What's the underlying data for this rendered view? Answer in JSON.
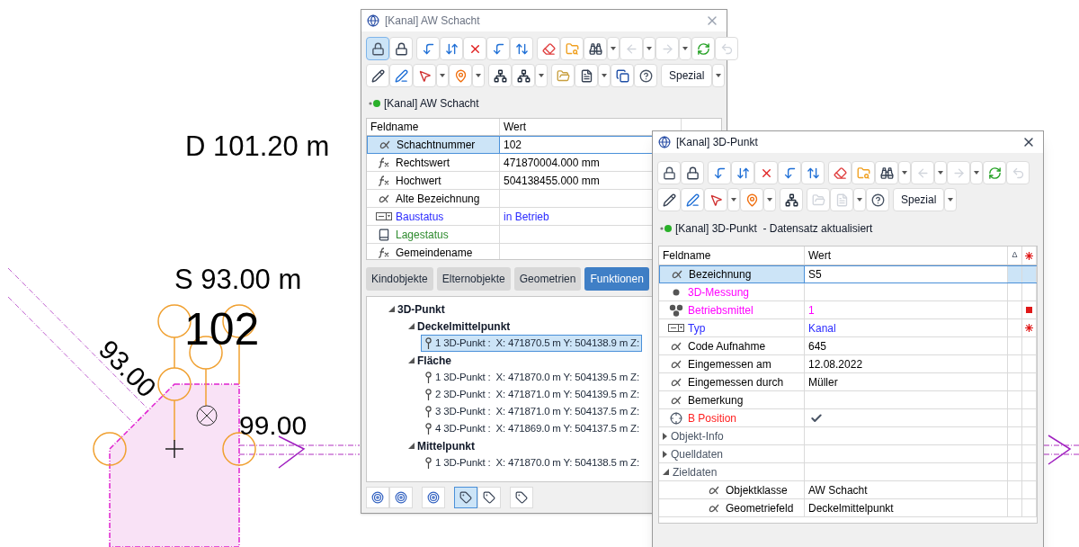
{
  "canvas": {
    "labels": [
      {
        "text": "D 101.20 m"
      },
      {
        "text": "S 93.00 m"
      },
      {
        "text": "102"
      },
      {
        "text": "93.00"
      },
      {
        "text": "99.00"
      }
    ]
  },
  "windows": [
    {
      "title": "[Kanal] AW Schacht",
      "active": false,
      "toolbar": [
        [
          [
            {
              "kind": "points-lock",
              "selected": true,
              "disabled": false
            },
            {
              "kind": "lock",
              "selected": false,
              "disabled": false
            }
          ],
          [
            {
              "kind": "arrow-down",
              "selected": false,
              "disabled": false
            },
            {
              "kind": "arrows-swap",
              "selected": false,
              "disabled": false
            },
            {
              "kind": "delete",
              "selected": false,
              "disabled": false
            },
            {
              "kind": "arrow-down-link",
              "selected": false,
              "disabled": false
            },
            {
              "kind": "arrows-swap-link",
              "selected": false,
              "disabled": false
            }
          ],
          [
            {
              "kind": "eraser",
              "selected": false,
              "disabled": false
            },
            {
              "kind": "folder-search",
              "selected": false,
              "disabled": false
            },
            {
              "kind": "binoculars",
              "selected": false,
              "disabled": false
            },
            {
              "kind": "caret",
              "selected": false,
              "disabled": false
            },
            {
              "kind": "back",
              "selected": false,
              "disabled": true
            },
            {
              "kind": "caret",
              "selected": false,
              "disabled": false
            },
            {
              "kind": "forward",
              "selected": false,
              "disabled": true
            },
            {
              "kind": "caret",
              "selected": false,
              "disabled": false
            },
            {
              "kind": "refresh",
              "selected": false,
              "disabled": false
            },
            {
              "kind": "undo",
              "selected": false,
              "disabled": true
            }
          ]
        ],
        [
          [
            {
              "kind": "pen",
              "selected": false,
              "disabled": false
            },
            {
              "kind": "pen-form",
              "selected": false,
              "disabled": false
            },
            {
              "kind": "curve",
              "selected": false,
              "disabled": false
            },
            {
              "kind": "caret",
              "selected": false,
              "disabled": false
            },
            {
              "kind": "pin",
              "selected": false,
              "disabled": false
            },
            {
              "kind": "caret",
              "selected": false,
              "disabled": false
            }
          ],
          [
            {
              "kind": "tree",
              "selected": false,
              "disabled": false
            },
            {
              "kind": "tree",
              "selected": false,
              "disabled": false
            },
            {
              "kind": "caret",
              "selected": false,
              "disabled": false
            }
          ],
          [
            {
              "kind": "folder-image",
              "selected": false,
              "disabled": false
            },
            {
              "kind": "document",
              "selected": false,
              "disabled": false
            },
            {
              "kind": "caret",
              "selected": false,
              "disabled": false
            },
            {
              "kind": "copy",
              "selected": false,
              "disabled": false
            },
            {
              "kind": "help",
              "selected": false,
              "disabled": false
            }
          ],
          [
            {
              "kind": "text",
              "label": "Spezial",
              "selected": false,
              "disabled": false
            },
            {
              "kind": "caret",
              "selected": false,
              "disabled": false
            }
          ]
        ]
      ],
      "status": "[Kanal] AW Schacht",
      "columns": [
        "Feldname",
        "Wert"
      ],
      "rows": [
        {
          "kind": "alpha",
          "label": "Schachtnummer",
          "value": "102",
          "selected": true
        },
        {
          "kind": "formula",
          "label": "Rechtswert",
          "value": "471870004.000 mm",
          "selected": false
        },
        {
          "kind": "formula",
          "label": "Hochwert",
          "value": "504138455.000 mm",
          "selected": false
        },
        {
          "kind": "alpha",
          "label": "Alte Bezeichnung",
          "selected": false
        },
        {
          "kind": "list",
          "label": "Baustatus",
          "value": "in Betrieb",
          "color": "#2b2bff",
          "selected": false
        },
        {
          "kind": "book",
          "label": "Lagestatus",
          "color": "#2e8b2e",
          "selected": false
        },
        {
          "kind": "formula",
          "label": "Gemeindename",
          "selected": false
        }
      ],
      "tabs": [
        {
          "label": "Kindobjekte",
          "selected": false
        },
        {
          "label": "Elternobjekte",
          "selected": false
        },
        {
          "label": "Geometrien",
          "selected": false
        },
        {
          "label": "Funktionen",
          "selected": true
        }
      ],
      "tree": [
        {
          "label": "3D-Punkt",
          "expanded": true,
          "children": [
            {
              "label": "Deckelmittelpunkt",
              "expanded": true,
              "children": [
                {
                  "label": "1 3D-Punkt :  X: 471870.5 m Y: 504138.9 m Z:",
                  "selected": true
                }
              ]
            },
            {
              "label": "Fläche",
              "expanded": true,
              "children": [
                {
                  "label": "1 3D-Punkt :  X: 471870.0 m Y: 504139.5 m Z:",
                  "selected": false
                },
                {
                  "label": "2 3D-Punkt :  X: 471871.0 m Y: 504139.5 m Z:",
                  "selected": false
                },
                {
                  "label": "3 3D-Punkt :  X: 471871.0 m Y: 504137.5 m Z:",
                  "selected": false
                },
                {
                  "label": "4 3D-Punkt :  X: 471869.0 m Y: 504137.5 m Z:",
                  "selected": false
                }
              ]
            },
            {
              "label": "Mittelpunkt",
              "expanded": true,
              "children": [
                {
                  "label": "1 3D-Punkt :  X: 471870.0 m Y: 504138.5 m Z:",
                  "selected": false
                }
              ]
            }
          ]
        }
      ],
      "bottom_toolbar": [
        [
          {
            "kind": "node-up",
            "selected": false
          },
          {
            "kind": "node-down",
            "selected": false
          }
        ],
        [
          {
            "kind": "snap",
            "selected": false
          }
        ],
        [
          {
            "kind": "label-bp",
            "selected": true
          },
          {
            "kind": "label-xbp",
            "selected": false
          }
        ],
        [
          {
            "kind": "label-xup",
            "selected": false
          }
        ]
      ]
    },
    {
      "title": "[Kanal] 3D-Punkt",
      "active": true,
      "toolbar": [
        [
          [
            {
              "kind": "points-lock",
              "selected": false,
              "disabled": false
            },
            {
              "kind": "lock",
              "selected": false,
              "disabled": false
            }
          ],
          [
            {
              "kind": "arrow-down",
              "selected": false,
              "disabled": false
            },
            {
              "kind": "arrows-swap",
              "selected": false,
              "disabled": false
            },
            {
              "kind": "delete",
              "selected": false,
              "disabled": false
            },
            {
              "kind": "arrow-down-link",
              "selected": false,
              "disabled": false
            },
            {
              "kind": "arrows-swap-link",
              "selected": false,
              "disabled": false
            }
          ],
          [
            {
              "kind": "eraser",
              "selected": false,
              "disabled": false
            },
            {
              "kind": "folder-search",
              "selected": false,
              "disabled": false
            },
            {
              "kind": "binoculars",
              "selected": false,
              "disabled": false
            },
            {
              "kind": "caret",
              "selected": false,
              "disabled": false
            },
            {
              "kind": "back",
              "selected": false,
              "disabled": true
            },
            {
              "kind": "caret",
              "selected": false,
              "disabled": false
            },
            {
              "kind": "forward",
              "selected": false,
              "disabled": true
            },
            {
              "kind": "caret",
              "selected": false,
              "disabled": false
            },
            {
              "kind": "refresh",
              "selected": false,
              "disabled": false
            },
            {
              "kind": "undo",
              "selected": false,
              "disabled": true
            }
          ]
        ],
        [
          [
            {
              "kind": "pen",
              "selected": false,
              "disabled": false
            },
            {
              "kind": "pen-form",
              "selected": false,
              "disabled": false
            },
            {
              "kind": "curve",
              "selected": false,
              "disabled": false
            },
            {
              "kind": "caret",
              "selected": false,
              "disabled": false
            },
            {
              "kind": "pin",
              "selected": false,
              "disabled": false
            },
            {
              "kind": "caret",
              "selected": false,
              "disabled": false
            }
          ],
          [
            {
              "kind": "tree",
              "selected": false,
              "disabled": false
            }
          ],
          [
            {
              "kind": "folder-image",
              "selected": false,
              "disabled": true
            },
            {
              "kind": "document",
              "selected": false,
              "disabled": true
            },
            {
              "kind": "caret",
              "selected": false,
              "disabled": false
            },
            {
              "kind": "help",
              "selected": false,
              "disabled": false
            }
          ],
          [
            {
              "kind": "text",
              "label": "Spezial",
              "selected": false,
              "disabled": false
            },
            {
              "kind": "caret",
              "selected": false,
              "disabled": false
            }
          ]
        ]
      ],
      "status": "[Kanal] 3D-Punkt  - Datensatz aktualisiert",
      "columns": [
        "Feldname",
        "Wert",
        "Δ"
      ],
      "rows": [
        {
          "kind": "alpha",
          "label": "Bezeichnung",
          "value": "S5",
          "selected": true,
          "flagged": false,
          "required": false
        },
        {
          "kind": "dot",
          "label": "3D-Messung",
          "color": "#ff00ff",
          "selected": false,
          "flagged": false,
          "required": false
        },
        {
          "kind": "dots",
          "label": "Betriebsmittel",
          "value": "1",
          "color": "#ff00ff",
          "selected": false,
          "flagged": true,
          "required": false
        },
        {
          "kind": "list",
          "label": "Typ",
          "value": "Kanal",
          "color": "#2b2bff",
          "selected": false,
          "flagged": false,
          "required": true
        },
        {
          "kind": "alpha",
          "label": "Code Aufnahme",
          "value": "645",
          "selected": false,
          "flagged": false,
          "required": false
        },
        {
          "kind": "alpha",
          "label": "Eingemessen am",
          "value": "12.08.2022",
          "selected": false,
          "flagged": false,
          "required": false
        },
        {
          "kind": "alpha",
          "label": "Eingemessen durch",
          "value": "Müller",
          "selected": false,
          "flagged": false,
          "required": false
        },
        {
          "kind": "alpha",
          "label": "Bemerkung",
          "selected": false,
          "flagged": false,
          "required": false
        },
        {
          "kind": "crosshair",
          "label": "B Position",
          "checked": true,
          "color": "#ff2020",
          "selected": false,
          "flagged": false,
          "required": false
        },
        {
          "kind": "group",
          "label": "Objekt-Info",
          "expanded": false
        },
        {
          "kind": "group",
          "label": "Quelldaten",
          "expanded": false
        },
        {
          "kind": "group",
          "label": "Zieldaten",
          "expanded": true,
          "children": [
            {
              "kind": "alpha",
              "label": "Objektklasse",
              "value": "AW Schacht",
              "selected": false,
              "flagged": false,
              "required": false
            },
            {
              "kind": "alpha",
              "label": "Geometriefeld",
              "value": "Deckelmittelpunkt",
              "selected": false,
              "flagged": false,
              "required": false
            }
          ]
        }
      ]
    }
  ]
}
